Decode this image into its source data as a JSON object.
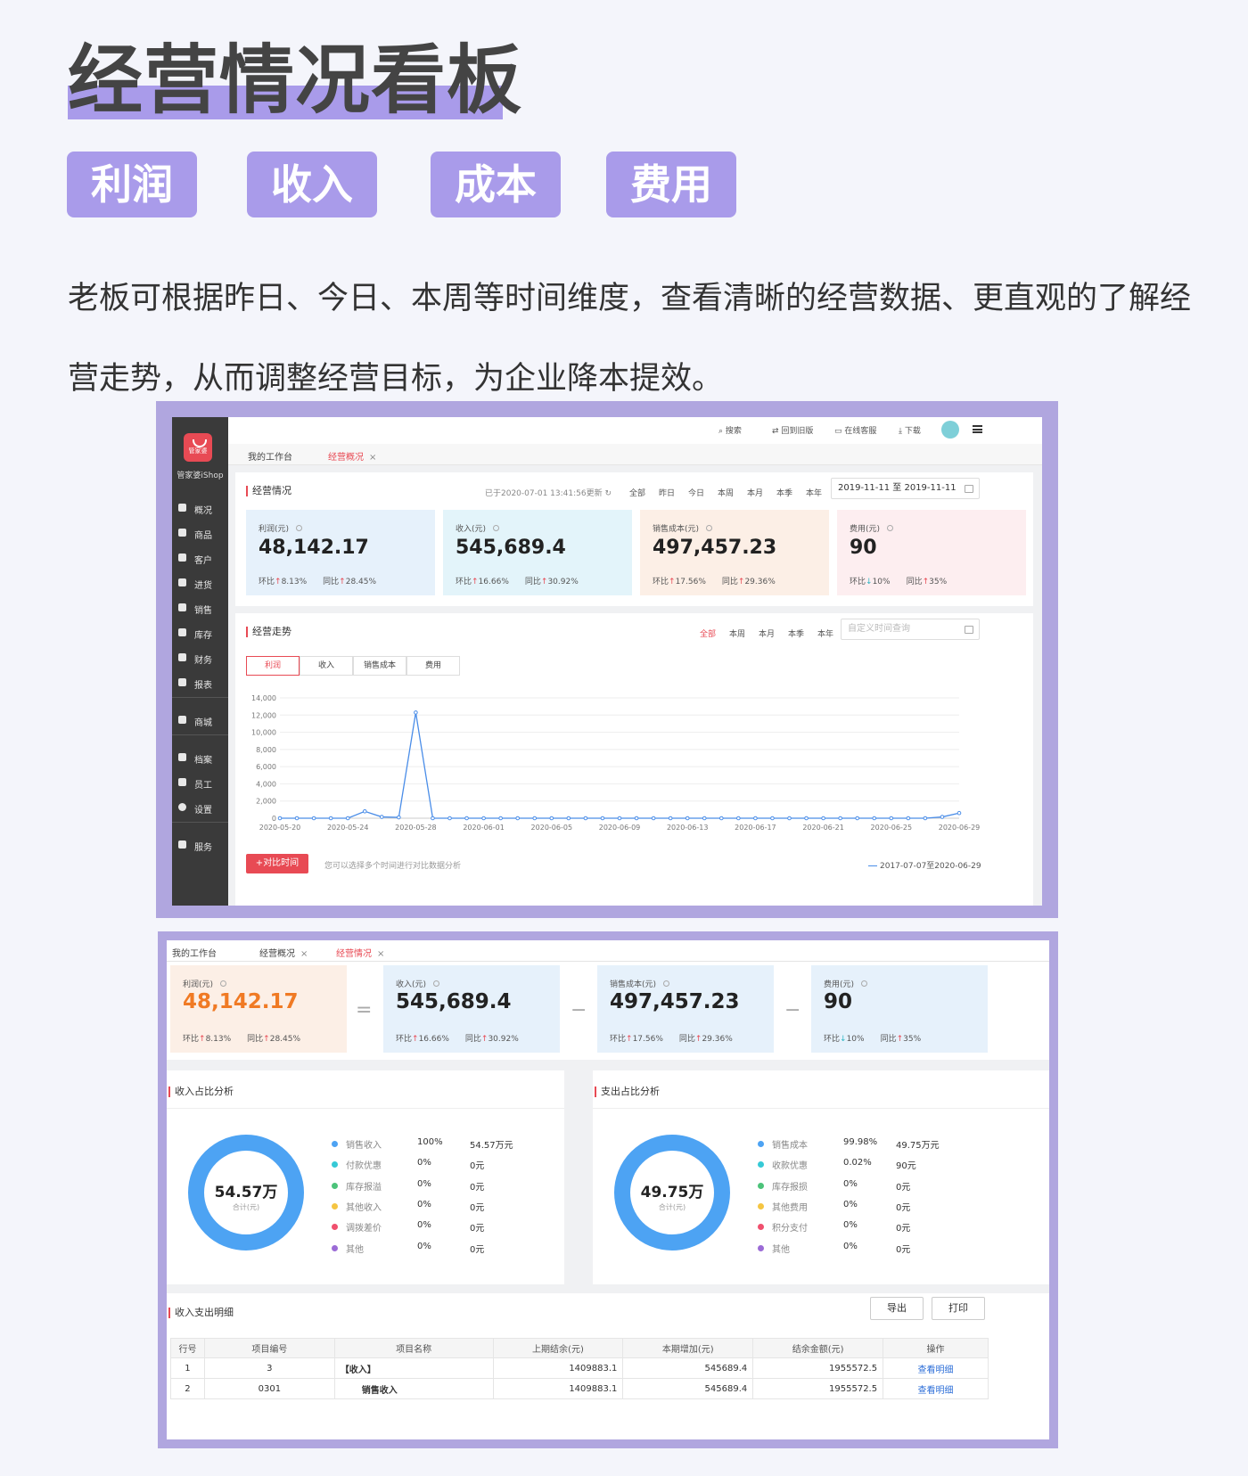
{
  "hero": {
    "title": "经营情况看板",
    "tags": [
      "利润",
      "收入",
      "成本",
      "费用"
    ],
    "description": "老板可根据昨日、今日、本周等时间维度，查看清晰的经营数据、更直观的了解经营走势，从而调整经营目标，为企业降本提效。"
  },
  "app1": {
    "logo_text": "管家婆",
    "brand": "管家婆iShop",
    "nav": [
      "概况",
      "商品",
      "客户",
      "进货",
      "销售",
      "库存",
      "财务",
      "报表",
      "商城",
      "档案",
      "员工",
      "设置",
      "服务"
    ],
    "topbar": [
      "搜索",
      "回到旧版",
      "在线客服",
      "下载"
    ],
    "tabs": [
      {
        "label": "我的工作台",
        "active": false
      },
      {
        "label": "经营概况",
        "active": true
      }
    ],
    "overview": {
      "title": "经营情况",
      "updated": "已于2020-07-01 13:41:56更新",
      "ranges": [
        "全部",
        "昨日",
        "今日",
        "本周",
        "本月",
        "本季",
        "本年"
      ],
      "date_range": "2019-11-11 至 2019-11-11"
    },
    "kpis": [
      {
        "label": "利润(元)",
        "value": "48,142.17",
        "hb_label": "环比",
        "hb_dir": "up",
        "hb": "8.13%",
        "tb_label": "同比",
        "tb_dir": "up",
        "tb": "28.45%",
        "bg": "#e6f1fb"
      },
      {
        "label": "收入(元)",
        "value": "545,689.4",
        "hb_label": "环比",
        "hb_dir": "up",
        "hb": "16.66%",
        "tb_label": "同比",
        "tb_dir": "up",
        "tb": "30.92%",
        "bg": "#e3f4fa"
      },
      {
        "label": "销售成本(元)",
        "value": "497,457.23",
        "hb_label": "环比",
        "hb_dir": "up",
        "hb": "17.56%",
        "tb_label": "同比",
        "tb_dir": "up",
        "tb": "29.36%",
        "bg": "#fcefe6"
      },
      {
        "label": "费用(元)",
        "value": "90",
        "hb_label": "环比",
        "hb_dir": "down",
        "hb": "10%",
        "tb_label": "同比",
        "tb_dir": "up",
        "tb": "35%",
        "bg": "#fdeef0"
      }
    ],
    "trend": {
      "title": "经营走势",
      "ranges": [
        "全部",
        "本周",
        "本月",
        "本季",
        "本年"
      ],
      "custom_placeholder": "自定义时间查询",
      "chart_tabs": [
        "利润",
        "收入",
        "销售成本",
        "费用"
      ],
      "compare_button": "对比时间",
      "compare_hint": "您可以选择多个时间进行对比数据分析",
      "legend": "2017-07-07至2020-06-29"
    }
  },
  "chart_data": {
    "type": "line",
    "x": [
      "2020-05-20",
      "2020-05-21",
      "2020-05-22",
      "2020-05-23",
      "2020-05-24",
      "2020-05-25",
      "2020-05-26",
      "2020-05-27",
      "2020-05-28",
      "2020-05-29",
      "2020-05-30",
      "2020-05-31",
      "2020-06-01",
      "2020-06-02",
      "2020-06-03",
      "2020-06-04",
      "2020-06-05",
      "2020-06-06",
      "2020-06-07",
      "2020-06-08",
      "2020-06-09",
      "2020-06-10",
      "2020-06-11",
      "2020-06-12",
      "2020-06-13",
      "2020-06-14",
      "2020-06-15",
      "2020-06-16",
      "2020-06-17",
      "2020-06-18",
      "2020-06-19",
      "2020-06-20",
      "2020-06-21",
      "2020-06-22",
      "2020-06-23",
      "2020-06-24",
      "2020-06-25",
      "2020-06-26",
      "2020-06-27",
      "2020-06-28",
      "2020-06-29"
    ],
    "x_ticks": [
      "2020-05-20",
      "2020-05-24",
      "2020-05-28",
      "2020-06-01",
      "2020-06-05",
      "2020-06-09",
      "2020-06-13",
      "2020-06-17",
      "2020-06-21",
      "2020-06-25",
      "2020-06-29"
    ],
    "series": [
      {
        "name": "2017-07-07至2020-06-29",
        "color": "#4a8de8",
        "values": [
          0,
          0,
          0,
          0,
          0,
          800,
          150,
          100,
          12300,
          0,
          0,
          0,
          0,
          0,
          0,
          0,
          0,
          0,
          0,
          0,
          0,
          0,
          0,
          0,
          0,
          0,
          0,
          0,
          0,
          0,
          0,
          0,
          0,
          0,
          0,
          0,
          0,
          0,
          0,
          150,
          600
        ]
      }
    ],
    "ylim": [
      0,
      14000
    ],
    "y_ticks": [
      "0",
      "2,000",
      "4,000",
      "6,000",
      "8,000",
      "10,000",
      "12,000",
      "14,000"
    ],
    "grid": true
  },
  "app2": {
    "tabs": [
      {
        "label": "我的工作台",
        "active": false
      },
      {
        "label": "经营概况",
        "active": false
      },
      {
        "label": "经营情况",
        "active": true
      }
    ],
    "kpis": [
      {
        "label": "利润(元)",
        "value": "48,142.17",
        "hb_label": "环比",
        "hb_dir": "up",
        "hb": "8.13%",
        "tb_label": "同比",
        "tb_dir": "up",
        "tb": "28.45%",
        "bg": "#fcefe6",
        "value_color": "#f07a24"
      },
      {
        "label": "收入(元)",
        "value": "545,689.4",
        "hb_label": "环比",
        "hb_dir": "up",
        "hb": "16.66%",
        "tb_label": "同比",
        "tb_dir": "up",
        "tb": "30.92%",
        "bg": "#e6f1fb",
        "value_color": "#222"
      },
      {
        "label": "销售成本(元)",
        "value": "497,457.23",
        "hb_label": "环比",
        "hb_dir": "up",
        "hb": "17.56%",
        "tb_label": "同比",
        "tb_dir": "up",
        "tb": "29.36%",
        "bg": "#e6f1fb",
        "value_color": "#222"
      },
      {
        "label": "费用(元)",
        "value": "90",
        "hb_label": "环比",
        "hb_dir": "down",
        "hb": "10%",
        "tb_label": "同比",
        "tb_dir": "up",
        "tb": "35%",
        "bg": "#e6f1fb",
        "value_color": "#222"
      }
    ],
    "operators": [
      "=",
      "−",
      "−"
    ],
    "income": {
      "title": "收入占比分析",
      "total": "54.57万",
      "total_label": "合计(元)",
      "items": [
        {
          "name": "销售收入",
          "pct": "100%",
          "value": "54.57万元",
          "color": "#4da3f3"
        },
        {
          "name": "付款优惠",
          "pct": "0%",
          "value": "0元",
          "color": "#36c9d6"
        },
        {
          "name": "库存报溢",
          "pct": "0%",
          "value": "0元",
          "color": "#4cc37a"
        },
        {
          "name": "其他收入",
          "pct": "0%",
          "value": "0元",
          "color": "#f5c542"
        },
        {
          "name": "调拨差价",
          "pct": "0%",
          "value": "0元",
          "color": "#f0506e"
        },
        {
          "name": "其他",
          "pct": "0%",
          "value": "0元",
          "color": "#9b6bd6"
        }
      ]
    },
    "expense": {
      "title": "支出占比分析",
      "total": "49.75万",
      "total_label": "合计(元)",
      "items": [
        {
          "name": "销售成本",
          "pct": "99.98%",
          "value": "49.75万元",
          "color": "#4da3f3"
        },
        {
          "name": "收款优惠",
          "pct": "0.02%",
          "value": "90元",
          "color": "#36c9d6"
        },
        {
          "name": "库存报损",
          "pct": "0%",
          "value": "0元",
          "color": "#4cc37a"
        },
        {
          "name": "其他费用",
          "pct": "0%",
          "value": "0元",
          "color": "#f5c542"
        },
        {
          "name": "积分支付",
          "pct": "0%",
          "value": "0元",
          "color": "#f0506e"
        },
        {
          "name": "其他",
          "pct": "0%",
          "value": "0元",
          "color": "#9b6bd6"
        }
      ]
    },
    "detail": {
      "title": "收入支出明细",
      "export": "导出",
      "print": "打印",
      "headers": [
        "行号",
        "项目编号",
        "项目名称",
        "上期结余(元)",
        "本期增加(元)",
        "结余金额(元)",
        "操作"
      ],
      "rows": [
        [
          "1",
          "3",
          "【收入】",
          "1409883.1",
          "545689.4",
          "1955572.5",
          "查看明细"
        ],
        [
          "2",
          "0301",
          "销售收入",
          "1409883.1",
          "545689.4",
          "1955572.5",
          "查看明细"
        ]
      ]
    }
  }
}
